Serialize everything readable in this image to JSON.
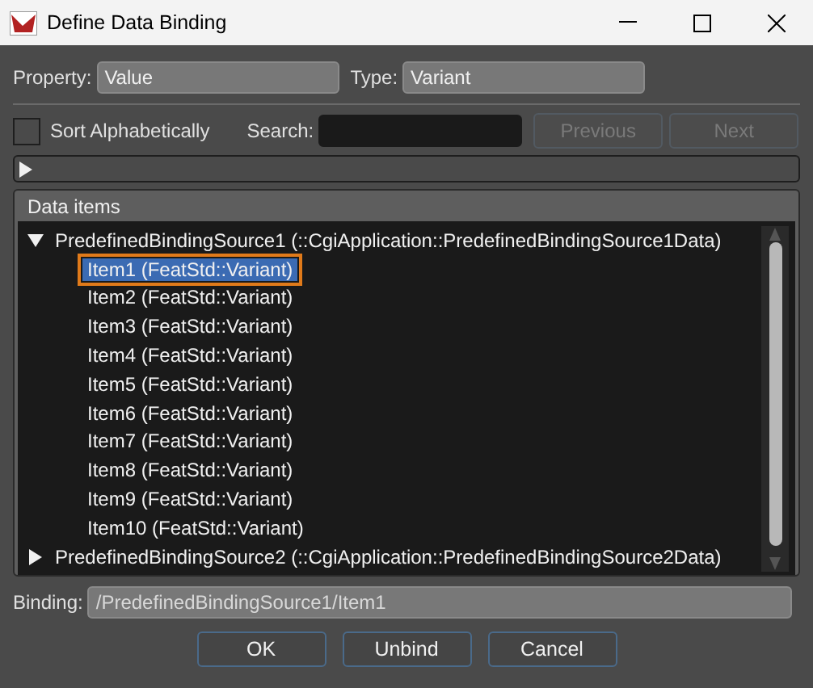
{
  "window": {
    "title": "Define Data Binding"
  },
  "property": {
    "label": "Property:",
    "value": "Value"
  },
  "type": {
    "label": "Type:",
    "value": "Variant"
  },
  "sort": {
    "label": "Sort Alphabetically",
    "checked": false
  },
  "search": {
    "label": "Search:"
  },
  "nav_buttons": [
    {
      "label": "Previous",
      "disabled": true
    },
    {
      "label": "Next",
      "disabled": true
    }
  ],
  "path_bar": {
    "expanded": false
  },
  "data_items": {
    "title": "Data items",
    "tree": [
      {
        "label": "PredefinedBindingSource1 (::CgiApplication::PredefinedBindingSource1Data)",
        "expanded": true,
        "children": [
          {
            "label": "Item1 (FeatStd::Variant)",
            "selected": true
          },
          {
            "label": "Item2 (FeatStd::Variant)",
            "selected": false
          },
          {
            "label": "Item3 (FeatStd::Variant)",
            "selected": false
          },
          {
            "label": "Item4 (FeatStd::Variant)",
            "selected": false
          },
          {
            "label": "Item5 (FeatStd::Variant)",
            "selected": false
          },
          {
            "label": "Item6 (FeatStd::Variant)",
            "selected": false
          },
          {
            "label": "Item7 (FeatStd::Variant)",
            "selected": false
          },
          {
            "label": "Item8 (FeatStd::Variant)",
            "selected": false
          },
          {
            "label": "Item9 (FeatStd::Variant)",
            "selected": false
          },
          {
            "label": "Item10 (FeatStd::Variant)",
            "selected": false
          }
        ]
      },
      {
        "label": "PredefinedBindingSource2 (::CgiApplication::PredefinedBindingSource2Data)",
        "expanded": false
      }
    ]
  },
  "binding": {
    "label": "Binding:",
    "value": "/PredefinedBindingSource1/Item1"
  },
  "buttons": [
    "OK",
    "Unbind",
    "Cancel"
  ]
}
